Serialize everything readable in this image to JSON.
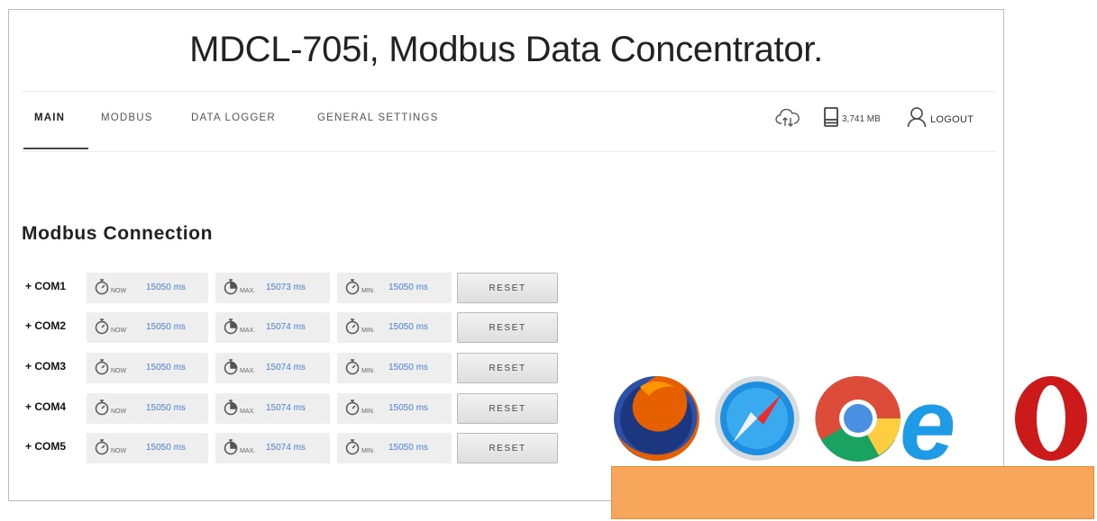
{
  "page": {
    "title": "MDCL-705i, Modbus Data Concentrator."
  },
  "nav": {
    "tabs": [
      {
        "label": "MAIN",
        "active": true
      },
      {
        "label": "MODBUS",
        "active": false
      },
      {
        "label": "DATA LOGGER",
        "active": false
      },
      {
        "label": "GENERAL SETTINGS",
        "active": false
      }
    ],
    "storage": "3,741 MB",
    "logout": "LOGOUT"
  },
  "section": {
    "title": "Modbus Connection"
  },
  "stat_labels": {
    "now": "NOW",
    "max": "MAX.",
    "min": "MIN."
  },
  "reset_label": "RESET",
  "connections": [
    {
      "label": "+ COM1",
      "now": "15050 ms",
      "max": "15073 ms",
      "min": "15050 ms"
    },
    {
      "label": "+ COM2",
      "now": "15050 ms",
      "max": "15074 ms",
      "min": "15050 ms"
    },
    {
      "label": "+ COM3",
      "now": "15050 ms",
      "max": "15074 ms",
      "min": "15050 ms"
    },
    {
      "label": "+ COM4",
      "now": "15050 ms",
      "max": "15074 ms",
      "min": "15050 ms"
    },
    {
      "label": "+ COM5",
      "now": "15050 ms",
      "max": "15074 ms",
      "min": "15050 ms"
    }
  ],
  "browser_icons": [
    "firefox-icon",
    "safari-icon",
    "chrome-icon",
    "internet-explorer-icon",
    "opera-icon"
  ],
  "colors": {
    "value_text": "#4a7fd0",
    "banner": "#f7a65c",
    "stat_background": "#eeeeee"
  }
}
